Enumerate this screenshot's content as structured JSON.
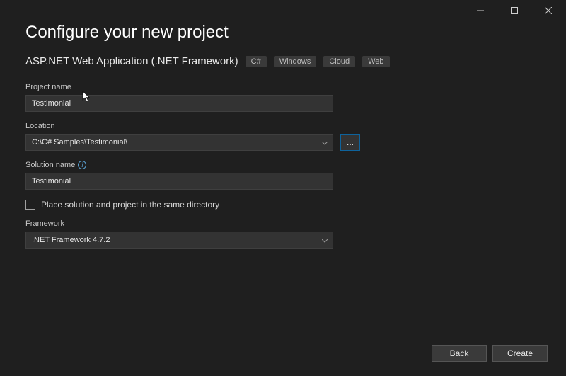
{
  "heading": "Configure your new project",
  "subtitle": "ASP.NET Web Application (.NET Framework)",
  "tags": [
    "C#",
    "Windows",
    "Cloud",
    "Web"
  ],
  "labels": {
    "project_name": "Project name",
    "location": "Location",
    "solution_name": "Solution name",
    "framework": "Framework",
    "same_dir": "Place solution and project in the same directory",
    "browse": "..."
  },
  "values": {
    "project_name": "Testimonial",
    "location": "C:\\C# Samples\\Testimonial\\",
    "solution_name": "Testimonial",
    "framework": ".NET Framework 4.7.2",
    "same_dir_checked": false
  },
  "buttons": {
    "back": "Back",
    "create": "Create"
  },
  "window_controls": {
    "minimize": "minimize",
    "maximize": "maximize",
    "close": "close"
  }
}
